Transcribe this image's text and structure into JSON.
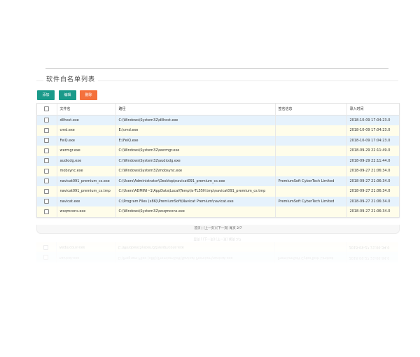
{
  "panel": {
    "title": "软件白名单列表"
  },
  "toolbar": {
    "add_label": "添加",
    "edit_label": "编辑",
    "delete_label": "删除"
  },
  "table": {
    "columns": [
      "文件名",
      "路径",
      "签名信息",
      "录入时间"
    ],
    "rows": [
      [
        "dllhost.exe",
        "C:\\Windows\\System32\\dllhost.exe",
        "",
        "2018-10-09 17:04:23.0"
      ],
      [
        "cmd.exe",
        "E:\\cmd.exe",
        "",
        "2018-10-09 17:04:23.0"
      ],
      [
        "FeiQ.exe",
        "E:\\FeiQ.exe",
        "",
        "2018-10-09 17:04:23.0"
      ],
      [
        "wermgr.exe",
        "C:\\Windows\\System32\\wermgr.exe",
        "",
        "2018-09-29 22:11:49.0"
      ],
      [
        "audiodg.exe",
        "C:\\Windows\\System32\\audiodg.exe",
        "",
        "2018-09-29 22:11:44.0"
      ],
      [
        "mobsync.exe",
        "C:\\Windows\\System32\\mobsync.exe",
        "",
        "2018-09-27 21:06:34.0"
      ],
      [
        "navicat091_premium_cs.exe",
        "C:\\Users\\Administrator\\Desktop\\navicat091_premium_cs.exe",
        "PremiumSoft CyberTech Limited",
        "2018-09-27 21:06:34.0"
      ],
      [
        "navicat091_premium_cs.tmp",
        "C:\\Users\\ADMINI~1\\AppData\\Local\\Temp\\is-TL55H.tmp\\navicat091_premium_cs.tmp",
        "",
        "2018-09-27 21:06:34.0"
      ],
      [
        "navicat.exe",
        "C:\\Program Files (x86)\\PremiumSoft\\Navicat Premium\\navicat.exe",
        "PremiumSoft CyberTech Limited",
        "2018-09-27 21:06:34.0"
      ],
      [
        "wsqmcons.exe",
        "C:\\Windows\\System32\\wsqmcons.exe",
        "",
        "2018-09-27 21:06:34.0"
      ]
    ]
  },
  "pager": {
    "text": "首页 | [上一页] [下一页] 尾页 2/7"
  },
  "colors": {
    "accent": "#1a9a8a",
    "danger": "#f4713c",
    "row_blue": "#e6f2fc",
    "row_yellow": "#fffdea"
  },
  "icons": {
    "row_checkbox": "checkbox-icon"
  }
}
